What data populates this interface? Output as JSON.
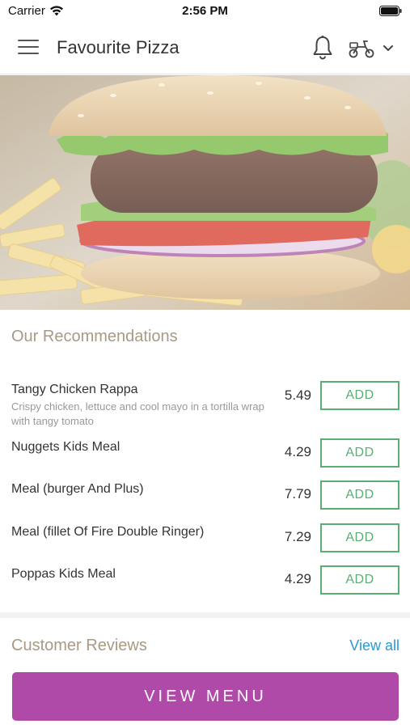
{
  "status_bar": {
    "carrier": "Carrier",
    "time": "2:56 PM"
  },
  "header": {
    "title": "Favourite Pizza",
    "icons": [
      "menu-icon",
      "bell-icon",
      "scooter-icon",
      "chevron-down-icon"
    ]
  },
  "hero": {
    "image": "burger-and-fries-photo"
  },
  "recommendations": {
    "title": "Our Recommendations",
    "items": [
      {
        "name": "Tangy Chicken Rappa",
        "description": "Crispy chicken, lettuce and cool mayo in a tortilla wrap with tangy tomato",
        "price": "5.49",
        "add_label": "ADD"
      },
      {
        "name": "Nuggets Kids Meal",
        "description": "",
        "price": "4.29",
        "add_label": "ADD"
      },
      {
        "name": "Meal (burger And Plus)",
        "description": "",
        "price": "7.79",
        "add_label": "ADD"
      },
      {
        "name": "Meal (fillet Of Fire Double Ringer)",
        "description": "",
        "price": "7.29",
        "add_label": "ADD"
      },
      {
        "name": "Poppas Kids Meal",
        "description": "",
        "price": "4.29",
        "add_label": "ADD"
      }
    ]
  },
  "reviews": {
    "title": "Customer Reviews",
    "view_all_label": "View all"
  },
  "footer": {
    "view_menu_label": "VIEW MENU"
  },
  "colors": {
    "accent_purple": "#b04aa8",
    "add_green": "#5cad74",
    "link_blue": "#2a9ad6",
    "section_title": "#a89a84"
  }
}
